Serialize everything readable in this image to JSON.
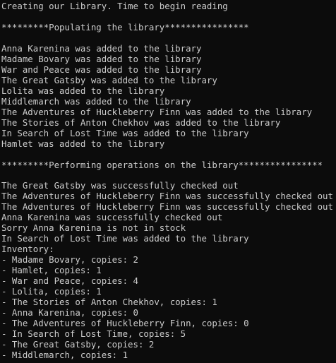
{
  "terminal": {
    "lines": [
      "Creating our Library. Time to begin reading",
      "",
      "*********Populating the library****************",
      "",
      "Anna Karenina was added to the library",
      "Madame Bovary was added to the library",
      "War and Peace was added to the library",
      "The Great Gatsby was added to the library",
      "Lolita was added to the library",
      "Middlemarch was added to the library",
      "The Adventures of Huckleberry Finn was added to the library",
      "The Stories of Anton Chekhov was added to the library",
      "In Search of Lost Time was added to the library",
      "Hamlet was added to the library",
      "",
      "*********Performing operations on the library****************",
      "",
      "The Great Gatsby was successfully checked out",
      "The Adventures of Huckleberry Finn was successfully checked out",
      "The Adventures of Huckleberry Finn was successfully checked out",
      "Anna Karenina was successfully checked out",
      "Sorry Anna Karenina is not in stock",
      "In Search of Lost Time was added to the library",
      "Inventory:",
      "- Madame Bovary, copies: 2",
      "- Hamlet, copies: 1",
      "- War and Peace, copies: 4",
      "- Lolita, copies: 1",
      "- The Stories of Anton Chekhov, copies: 1",
      "- Anna Karenina, copies: 0",
      "- The Adventures of Huckleberry Finn, copies: 0",
      "- In Search of Lost Time, copies: 5",
      "- The Great Gatsby, copies: 2",
      "- Middlemarch, copies: 1"
    ]
  }
}
